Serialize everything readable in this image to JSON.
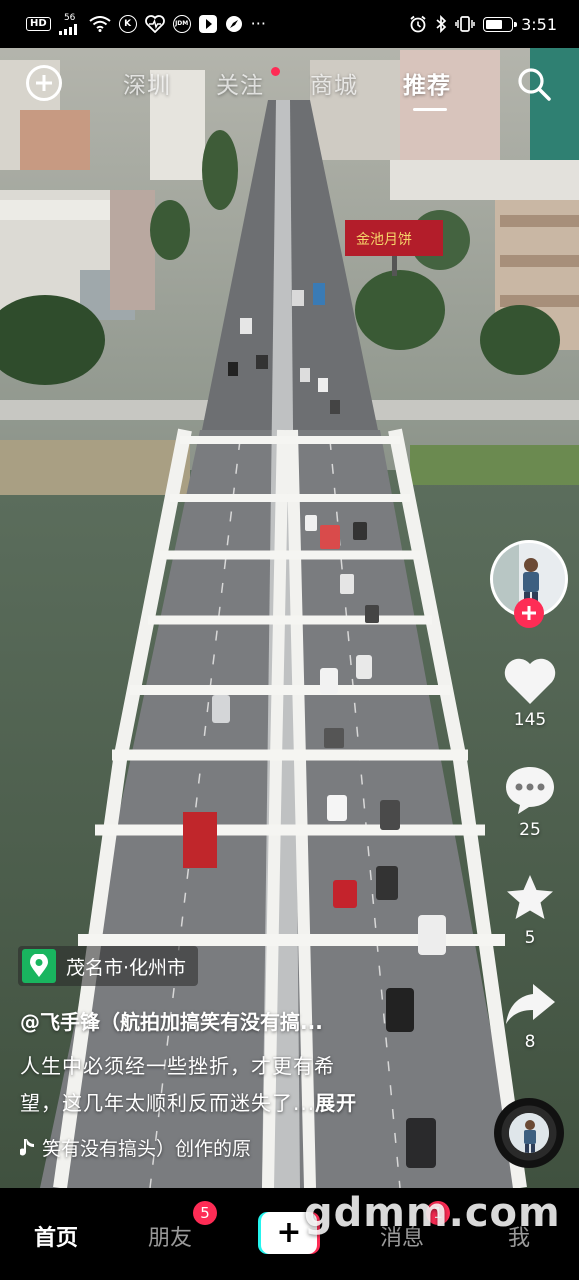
{
  "status_bar": {
    "left_labels": [
      "HD",
      "56",
      "K",
      "JDM"
    ],
    "dots": "···",
    "time": "3:51"
  },
  "top_nav": {
    "tabs": [
      "深圳",
      "关注",
      "商城",
      "推荐"
    ],
    "active_tab": "推荐"
  },
  "scene": {
    "billboard_text": "金池月饼"
  },
  "actions": {
    "likes": "145",
    "comments": "25",
    "favorites": "5",
    "shares": "8"
  },
  "post": {
    "location": "茂名市·化州市",
    "author": "@飞手锋（航拍加搞笑有没有搞...",
    "description_line1": "人生中必须经一些挫折，才更有希",
    "description_line2": "望，这几年太顺利反而迷失了...",
    "expand_label": "展开",
    "music": "笑有没有搞头）创作的原"
  },
  "bottom_nav": {
    "home": "首页",
    "friends": "朋友",
    "friends_badge": "5",
    "publish": "+",
    "messages": "消息",
    "messages_badge": "1",
    "me": "我"
  },
  "watermark": "gdmm.com",
  "colors": {
    "accent_red": "#fe2c55",
    "accent_cyan": "#25f4ee",
    "location_green": "#19b55f"
  }
}
